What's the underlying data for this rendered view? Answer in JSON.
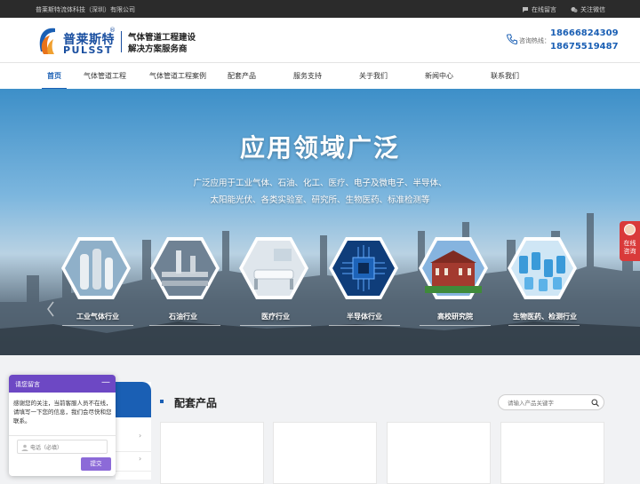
{
  "topbar": {
    "company": "普莱斯特流体科技（深圳）有限公司",
    "links": [
      {
        "label": "在线留言",
        "icon": "message-icon"
      },
      {
        "label": "关注微信",
        "icon": "wechat-icon"
      }
    ]
  },
  "header": {
    "logo_cn": "普莱斯特",
    "logo_en": "PULSST",
    "logo_reg": "®",
    "slogan_line1": "气体管道工程建设",
    "slogan_line2": "解决方案服务商",
    "hotline_label": "咨询热线：",
    "phones": [
      "18666824309",
      "18675519487"
    ]
  },
  "nav": {
    "items": [
      {
        "label": "首页",
        "active": true
      },
      {
        "label": "气体管道工程",
        "active": false
      },
      {
        "label": "气体管道工程案例",
        "active": false
      },
      {
        "label": "配套产品",
        "active": false
      },
      {
        "label": "服务支持",
        "active": false
      },
      {
        "label": "关于我们",
        "active": false
      },
      {
        "label": "新闻中心",
        "active": false
      },
      {
        "label": "联系我们",
        "active": false
      }
    ]
  },
  "banner": {
    "title": "应用领域广泛",
    "sub_line1": "广泛应用于工业气体、石油、化工、医疗、电子及微电子、半导体、",
    "sub_line2": "太阳能光伏、各类实验室、研究所、生物医药、标准检测等",
    "industries": [
      {
        "label": "工业气体行业",
        "icon": "industrial-gas-icon"
      },
      {
        "label": "石油行业",
        "icon": "petroleum-icon"
      },
      {
        "label": "医疗行业",
        "icon": "medical-icon"
      },
      {
        "label": "半导体行业",
        "icon": "semiconductor-icon"
      },
      {
        "label": "高校研究院",
        "icon": "university-icon"
      },
      {
        "label": "生物医药、检测行业",
        "icon": "biomedicine-icon"
      }
    ]
  },
  "side_consult": {
    "label": "在线咨询"
  },
  "products": {
    "title": "配套产品",
    "search_placeholder": "请输入产品关键字"
  },
  "chat": {
    "title": "请您留言",
    "minimize": "—",
    "message": "感谢您的关注，当前客服人员不在线，请填写一下您的信息，我们会尽快和您联系。",
    "input_placeholder": "电话（必填）",
    "submit": "提交"
  },
  "colors": {
    "brand_blue": "#1a5fb4",
    "chat_purple": "#6d48c4",
    "consult_red": "#d93a3a"
  }
}
